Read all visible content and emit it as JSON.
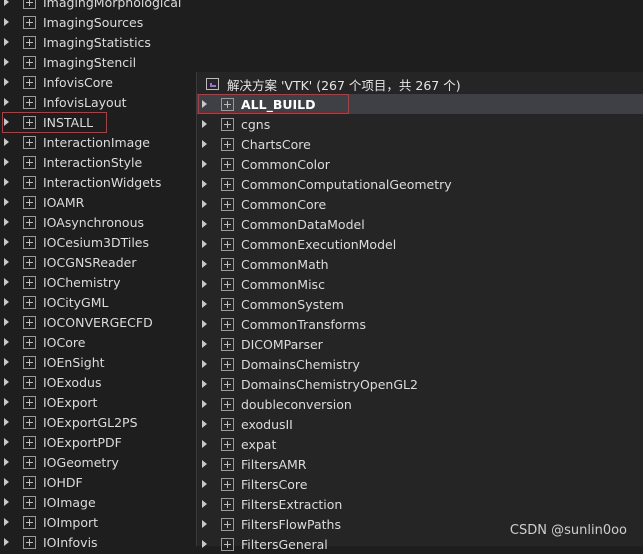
{
  "left_tree": {
    "items": [
      "ImagingMorphological",
      "ImagingSources",
      "ImagingStatistics",
      "ImagingStencil",
      "InfovisCore",
      "InfovisLayout",
      "INSTALL",
      "InteractionImage",
      "InteractionStyle",
      "InteractionWidgets",
      "IOAMR",
      "IOAsynchronous",
      "IOCesium3DTiles",
      "IOCGNSReader",
      "IOChemistry",
      "IOCityGML",
      "IOCONVERGECFD",
      "IOCore",
      "IOEnSight",
      "IOExodus",
      "IOExport",
      "IOExportGL2PS",
      "IOExportPDF",
      "IOGeometry",
      "IOHDF",
      "IOImage",
      "IOImport",
      "IOInfovis"
    ]
  },
  "solution_explorer": {
    "header": "解决方案 'VTK' (267 个项目，共 267 个)",
    "items": [
      "ALL_BUILD",
      "cgns",
      "ChartsCore",
      "CommonColor",
      "CommonComputationalGeometry",
      "CommonCore",
      "CommonDataModel",
      "CommonExecutionModel",
      "CommonMath",
      "CommonMisc",
      "CommonSystem",
      "CommonTransforms",
      "DICOMParser",
      "DomainsChemistry",
      "DomainsChemistryOpenGL2",
      "doubleconversion",
      "exodusII",
      "expat",
      "FiltersAMR",
      "FiltersCore",
      "FiltersExtraction",
      "FiltersFlowPaths",
      "FiltersGeneral"
    ],
    "selected": "ALL_BUILD"
  },
  "watermark": "CSDN @sunlin0oo",
  "colors": {
    "background": "#1e1e1e",
    "panel": "#252526",
    "highlight": "#e0282e",
    "selection": "#3f3f46"
  }
}
